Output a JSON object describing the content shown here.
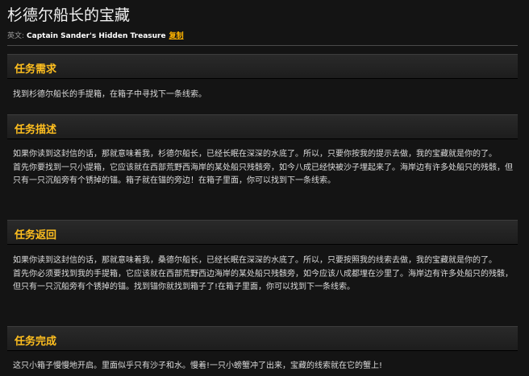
{
  "quest": {
    "title": "杉德尔船长的宝藏",
    "english_prefix": "英文:",
    "english_name": "Captain Sander's Hidden Treasure",
    "copy_label": "复制"
  },
  "sections": {
    "requirement": {
      "heading": "任务需求",
      "text": "找到杉德尔船长的手提箱，在箱子中寻找下一条线索。"
    },
    "description": {
      "heading": "任务描述",
      "paragraph1": "如果你读到这封信的话，那就意味着我，杉德尔船长，已经长眠在深深的水底了。所以，只要你按我的提示去做，我的宝藏就是你的了。",
      "paragraph2": "首先你要找到一只小提箱，它应该就在西部荒野西海岸的某处船只残骸旁，如今八成已经快被沙子埋起来了。海岸边有许多处船只的残骸，但只有一只沉船旁有个锈掉的锚。箱子就在锚的旁边！在箱子里面，你可以找到下一条线索。"
    },
    "return": {
      "heading": "任务返回",
      "paragraph1": "如果你读到这封信的话，那就意味着我，桑德尔船长，已经长眠在深深的水底了。所以，只要按照我的线索去做，我的宝藏就是你的了。",
      "paragraph2": "首先你必须要找到我的手提箱，它应该就在西部荒野西边海岸的某处船只残骸旁，如今应该八成都埋在沙里了。海岸边有许多处船只的残骸，但只有一只沉船旁有个锈掉的锚。找到锚你就找到箱子了!在箱子里面，你可以找到下一条线索。"
    },
    "complete": {
      "heading": "任务完成",
      "text": "这只小箱子慢慢地开启。里面似乎只有沙子和水。慢着!一只小螃蟹冲了出来，宝藏的线索就在它的蟹上!"
    }
  }
}
